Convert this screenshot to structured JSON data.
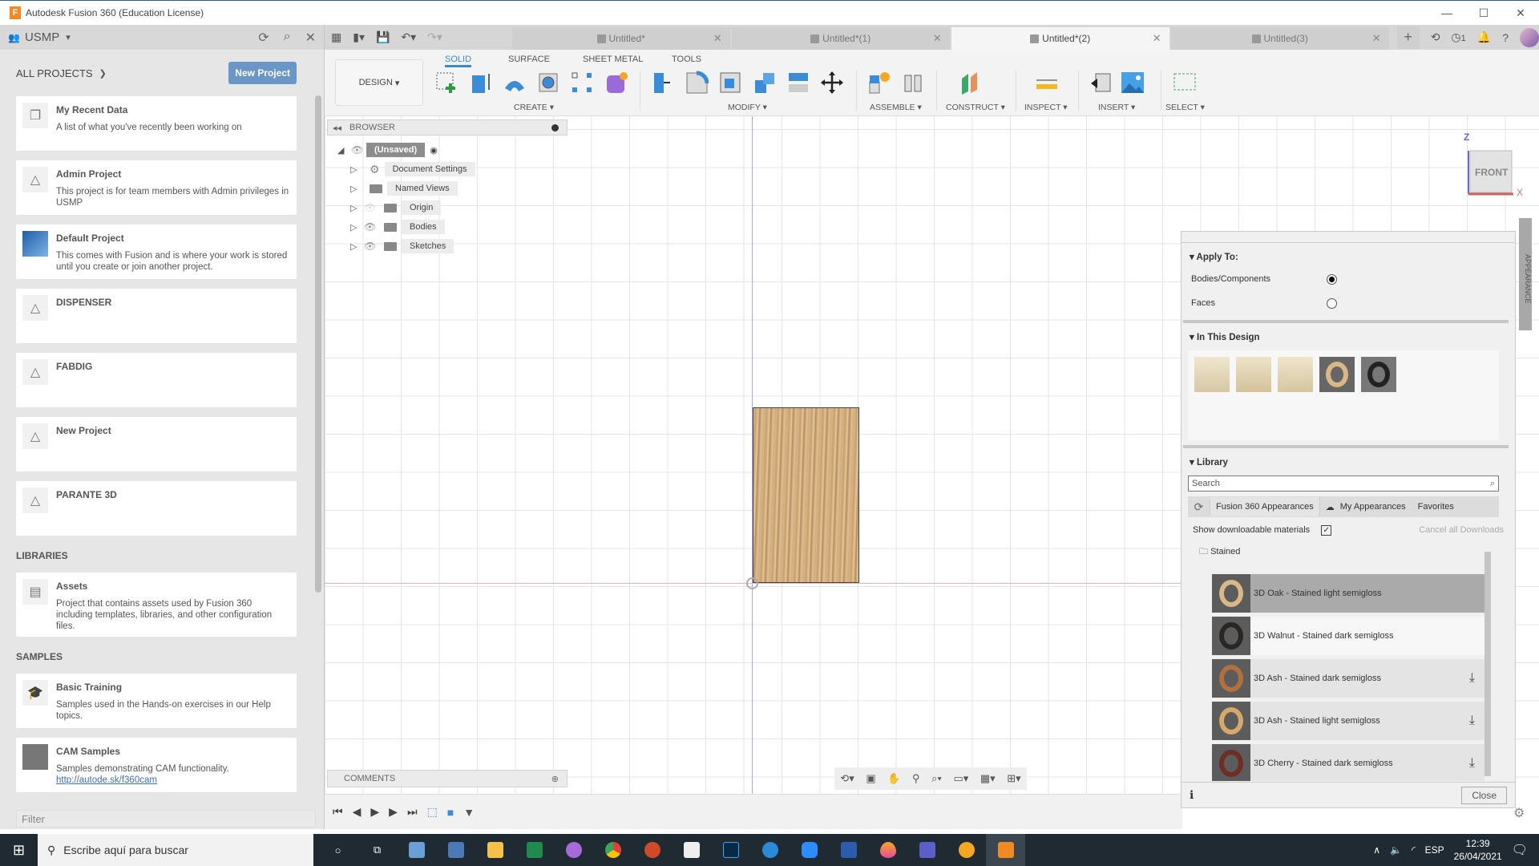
{
  "window": {
    "title": "Autodesk Fusion 360 (Education License)",
    "controls": [
      "minimize",
      "maximize",
      "close"
    ]
  },
  "data_panel": {
    "team": "USMP",
    "all_projects_label": "ALL PROJECTS",
    "new_project_button": "New Project",
    "projects": [
      {
        "name": "My Recent Data",
        "desc": "A list of what you've recently been working on",
        "icon": "documents-icon"
      },
      {
        "name": "Admin Project",
        "desc": "This project is for team members with Admin privileges in USMP",
        "icon": "project-icon"
      },
      {
        "name": "Default Project",
        "desc": "This comes with Fusion and is where your work is stored until you create or join another project.",
        "icon": "default-project-thumb"
      },
      {
        "name": "DISPENSER",
        "desc": "",
        "icon": "project-icon"
      },
      {
        "name": "FABDIG",
        "desc": "",
        "icon": "project-icon"
      },
      {
        "name": "New Project",
        "desc": "",
        "icon": "project-icon"
      },
      {
        "name": "PARANTE 3D",
        "desc": "",
        "icon": "project-icon"
      }
    ],
    "libraries_label": "LIBRARIES",
    "libraries": [
      {
        "name": "Assets",
        "desc": "Project that contains assets used by Fusion 360 including templates, libraries, and other configuration files."
      }
    ],
    "samples_label": "SAMPLES",
    "samples": [
      {
        "name": "Basic Training",
        "desc": "Samples used in the Hands-on exercises in our Help topics."
      },
      {
        "name": "CAM Samples",
        "desc": "Samples demonstrating CAM functionality.",
        "link": "http://autode.sk/f360cam"
      }
    ],
    "filter_placeholder": "Filter"
  },
  "doc_tabs": [
    {
      "label": "Untitled*",
      "active": false
    },
    {
      "label": "Untitled*(1)",
      "active": false
    },
    {
      "label": "Untitled*(2)",
      "active": true
    },
    {
      "label": "Untitled(3)",
      "active": false
    }
  ],
  "job_count": "1",
  "ribbon": {
    "workspace": "DESIGN",
    "tabs": [
      "SOLID",
      "SURFACE",
      "SHEET METAL",
      "TOOLS"
    ],
    "active_tab": "SOLID",
    "groups": [
      "CREATE",
      "MODIFY",
      "ASSEMBLE",
      "CONSTRUCT",
      "INSPECT",
      "INSERT",
      "SELECT"
    ]
  },
  "browser": {
    "title": "BROWSER",
    "root": "(Unsaved)",
    "items": [
      "Document Settings",
      "Named Views",
      "Origin",
      "Bodies",
      "Sketches"
    ]
  },
  "viewcube": {
    "face": "FRONT",
    "axis_z": "Z",
    "axis_x": "X"
  },
  "comments_label": "COMMENTS",
  "appearance": {
    "side_tab": "APPEARANCE",
    "apply_to_label": "Apply To:",
    "apply_options": [
      {
        "label": "Bodies/Components",
        "selected": true
      },
      {
        "label": "Faces",
        "selected": false
      }
    ],
    "in_this_design_label": "In This Design",
    "library_label": "Library",
    "search_placeholder": "Search",
    "library_tabs": [
      "Fusion 360 Appearances",
      "My Appearances",
      "Favorites"
    ],
    "show_downloadable": "Show downloadable materials",
    "show_downloadable_checked": true,
    "cancel_downloads": "Cancel all Downloads",
    "folder": "Stained",
    "materials": [
      {
        "name": "3D Oak - Stained light semigloss",
        "color": "#d9b787",
        "download": false,
        "state": "selected"
      },
      {
        "name": "3D Walnut - Stained dark semigloss",
        "color": "#2a2624",
        "download": false,
        "state": "hover"
      },
      {
        "name": "3D Ash - Stained dark semigloss",
        "color": "#b07040",
        "download": true,
        "state": ""
      },
      {
        "name": "3D Ash - Stained light semigloss",
        "color": "#d4a96a",
        "download": true,
        "state": ""
      },
      {
        "name": "3D Cherry - Stained dark semigloss",
        "color": "#6e2e26",
        "download": true,
        "state": ""
      }
    ],
    "close_button": "Close"
  },
  "taskbar": {
    "search_placeholder": "Escribe aquí para buscar",
    "language": "ESP",
    "time": "12:39",
    "date": "26/04/2021"
  }
}
